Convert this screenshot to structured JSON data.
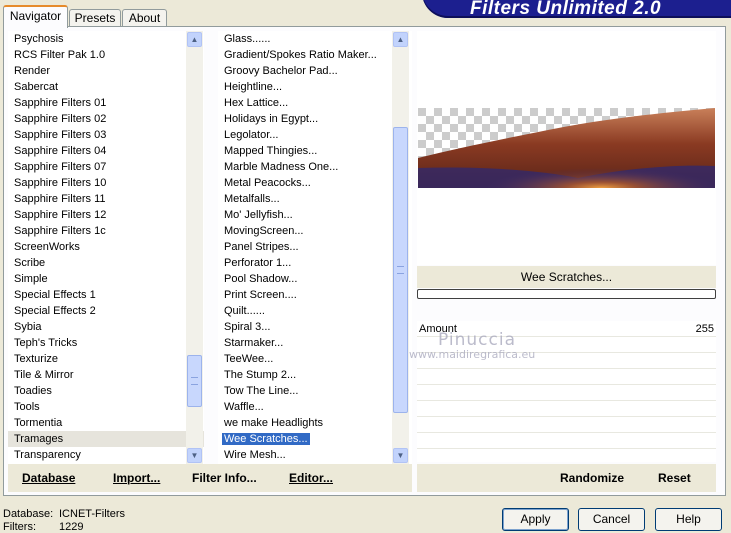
{
  "tabs": [
    {
      "label": "Navigator",
      "active": true
    },
    {
      "label": "Presets",
      "active": false
    },
    {
      "label": "About",
      "active": false
    }
  ],
  "banner": {
    "title": "Filters Unlimited 2.0"
  },
  "categories": {
    "items": [
      "Psychosis",
      "RCS Filter Pak 1.0",
      "Render",
      "Sabercat",
      "Sapphire Filters 01",
      "Sapphire Filters 02",
      "Sapphire Filters 03",
      "Sapphire Filters 04",
      "Sapphire Filters 07",
      "Sapphire Filters 10",
      "Sapphire Filters 11",
      "Sapphire Filters 12",
      "Sapphire Filters 1c",
      "ScreenWorks",
      "Scribe",
      "Simple",
      "Special Effects 1",
      "Special Effects 2",
      "Sybia",
      "Teph's Tricks",
      "Texturize",
      "Tile & Mirror",
      "Toadies",
      "Tools",
      "Tormentia",
      "Tramages",
      "Transparency"
    ],
    "selected": "Tramages"
  },
  "filters": {
    "items": [
      "Glass......",
      "Gradient/Spokes Ratio Maker...",
      "Groovy Bachelor Pad...",
      "Heightline...",
      "Hex Lattice...",
      "Holidays in Egypt...",
      "Legolator...",
      "Mapped Thingies...",
      "Marble Madness One...",
      "Metal Peacocks...",
      "Metalfalls...",
      "Mo' Jellyfish...",
      "MovingScreen...",
      "Panel Stripes...",
      "Perforator 1...",
      "Pool Shadow...",
      "Print Screen....",
      "Quilt......",
      "Spiral 3...",
      "Starmaker...",
      "TeeWee...",
      "The Stump 2...",
      "Tow The Line...",
      "Waffle...",
      "we make Headlights",
      "Wee Scratches...",
      "Wire Mesh..."
    ],
    "selected": "Wee Scratches..."
  },
  "filter_panel": {
    "title": "Wee Scratches...",
    "params": [
      {
        "label": "Amount",
        "value": "255"
      }
    ]
  },
  "watermark": {
    "line1": "Pinuccia",
    "line2": "www.maidiregrafica.eu"
  },
  "left_buttons": {
    "database": "Database",
    "import": "Import...",
    "filter_info": "Filter Info...",
    "editor": "Editor..."
  },
  "right_buttons": {
    "randomize": "Randomize",
    "reset": "Reset"
  },
  "status": {
    "database_label": "Database:",
    "database_value": "ICNET-Filters",
    "filters_label": "Filters:",
    "filters_value": "1229"
  },
  "dialog_buttons": {
    "apply": "Apply",
    "cancel": "Cancel",
    "help": "Help"
  },
  "colors": {
    "selection": "#316ac5",
    "banner": "#1c1f8f",
    "background": "#ece9d8"
  }
}
